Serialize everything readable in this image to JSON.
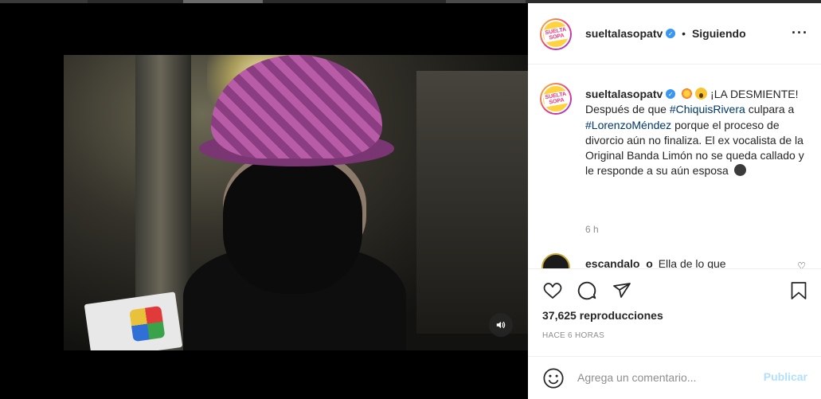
{
  "colors": {
    "accent": "#3897f0",
    "hashtag": "#00376b",
    "muted": "#8e8e8e",
    "post_disabled": "#b2dffc",
    "brand_gradient": [
      "#f7c533",
      "#e8377c",
      "#8f3ed6"
    ]
  },
  "header": {
    "username": "sueltalasopatv",
    "separator": "•",
    "follow_status": "Siguiendo",
    "more_icon": "more-horizontal-icon"
  },
  "video": {
    "sound_icon": "speaker-icon"
  },
  "caption": {
    "username": "sueltalasopatv",
    "text_1": "¡LA DESMIENTE! Después de que",
    "tag_1": "#ChiquisRivera",
    "text_2": "culpara a",
    "tag_2": "#LorenzoMéndez",
    "text_3": "porque el proceso de divorcio aún no finaliza. El ex vocalista de la Original Banda Limón no se queda callado y le responde a su aún esposa",
    "time": "6 h"
  },
  "comment_2": {
    "username": "escandalo_o",
    "text": "Ella de lo que"
  },
  "actions": {
    "like_icon": "heart-icon",
    "comment_icon": "comment-icon",
    "share_icon": "paper-plane-icon",
    "save_icon": "bookmark-icon",
    "views": "37,625 reproducciones",
    "ago": "HACE 6 HORAS"
  },
  "add_comment": {
    "placeholder": "Agrega un comentario...",
    "post_label": "Publicar"
  }
}
